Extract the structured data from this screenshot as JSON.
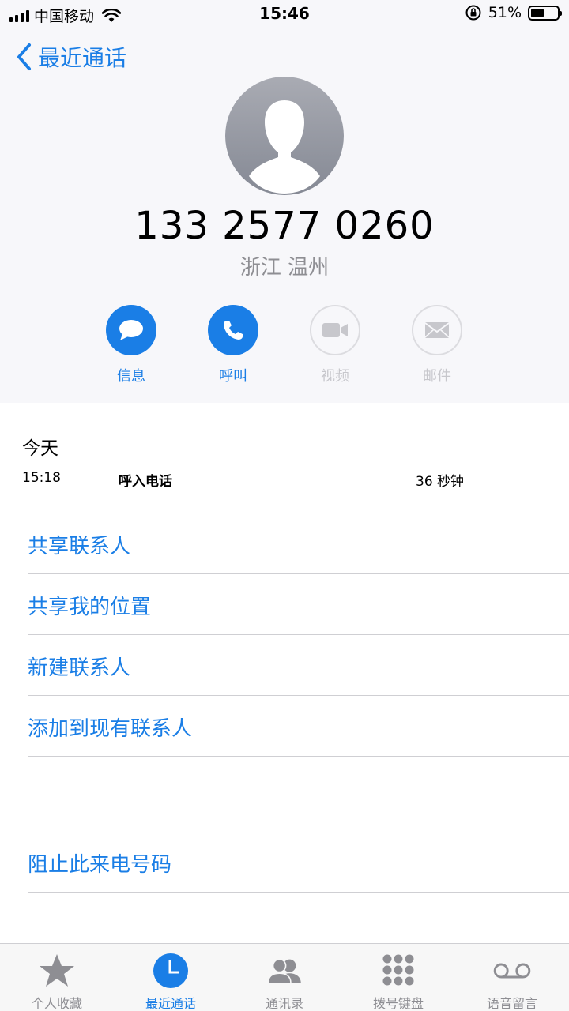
{
  "status_bar": {
    "carrier": "中国移动",
    "time": "15:46",
    "battery_text": "51%",
    "battery_level": 0.51
  },
  "nav": {
    "back_label": "最近通话"
  },
  "contact": {
    "number": "133 2577 0260",
    "location": "浙江 温州"
  },
  "actions": [
    {
      "label": "信息",
      "icon": "message-icon",
      "enabled": true
    },
    {
      "label": "呼叫",
      "icon": "phone-icon",
      "enabled": true
    },
    {
      "label": "视频",
      "icon": "video-icon",
      "enabled": false
    },
    {
      "label": "邮件",
      "icon": "mail-icon",
      "enabled": false
    }
  ],
  "history": {
    "day": "今天",
    "time": "15:18",
    "type": "呼入电话",
    "duration": "36 秒钟"
  },
  "options": {
    "share_contact": "共享联系人",
    "share_location": "共享我的位置",
    "new_contact": "新建联系人",
    "add_existing": "添加到现有联系人",
    "block": "阻止此来电号码"
  },
  "tabs": [
    {
      "label": "个人收藏",
      "icon": "star-icon",
      "active": false
    },
    {
      "label": "最近通话",
      "icon": "clock-icon",
      "active": true
    },
    {
      "label": "通讯录",
      "icon": "contacts-icon",
      "active": false
    },
    {
      "label": "拨号键盘",
      "icon": "keypad-icon",
      "active": false
    },
    {
      "label": "语音留言",
      "icon": "voicemail-icon",
      "active": false
    }
  ],
  "colors": {
    "accent": "#1a7ee6",
    "disabled": "#c7c7cc",
    "inactive_tab": "#8e8e93"
  }
}
